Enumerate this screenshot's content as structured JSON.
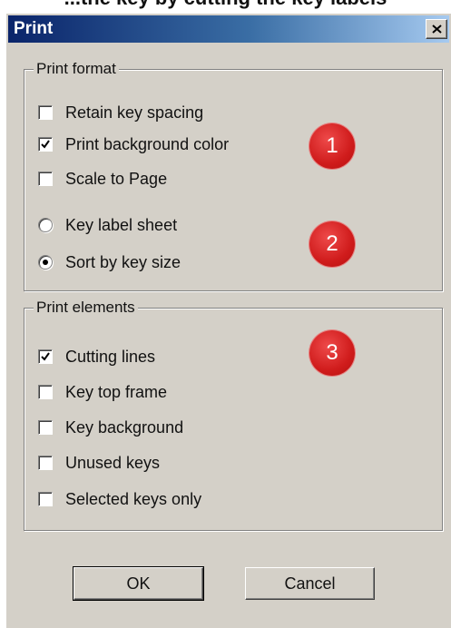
{
  "page": {
    "caption_partial": "...the key by cutting the key labels"
  },
  "window": {
    "title": "Print",
    "close_glyph": "✕"
  },
  "print_format": {
    "legend": "Print format",
    "options": [
      {
        "label": "Retain key spacing",
        "type": "checkbox",
        "checked": false
      },
      {
        "label": "Print background color",
        "type": "checkbox",
        "checked": true
      },
      {
        "label": "Scale to Page",
        "type": "checkbox",
        "checked": false
      }
    ],
    "radios": [
      {
        "label": "Key label sheet",
        "selected": false
      },
      {
        "label": "Sort by key size",
        "selected": true
      }
    ]
  },
  "print_elements": {
    "legend": "Print elements",
    "options": [
      {
        "label": "Cutting lines",
        "checked": true
      },
      {
        "label": "Key top frame",
        "checked": false
      },
      {
        "label": "Key background",
        "checked": false
      },
      {
        "label": "Unused keys",
        "checked": false
      },
      {
        "label": "Selected keys only",
        "checked": false
      }
    ]
  },
  "badges": [
    "1",
    "2",
    "3"
  ],
  "buttons": {
    "ok": "OK",
    "cancel": "Cancel"
  },
  "colors": {
    "dialog_bg": "#d4d0c8",
    "titlebar_start": "#0a246a",
    "titlebar_end": "#a6caf0",
    "badge_red": "#d01c1c"
  }
}
